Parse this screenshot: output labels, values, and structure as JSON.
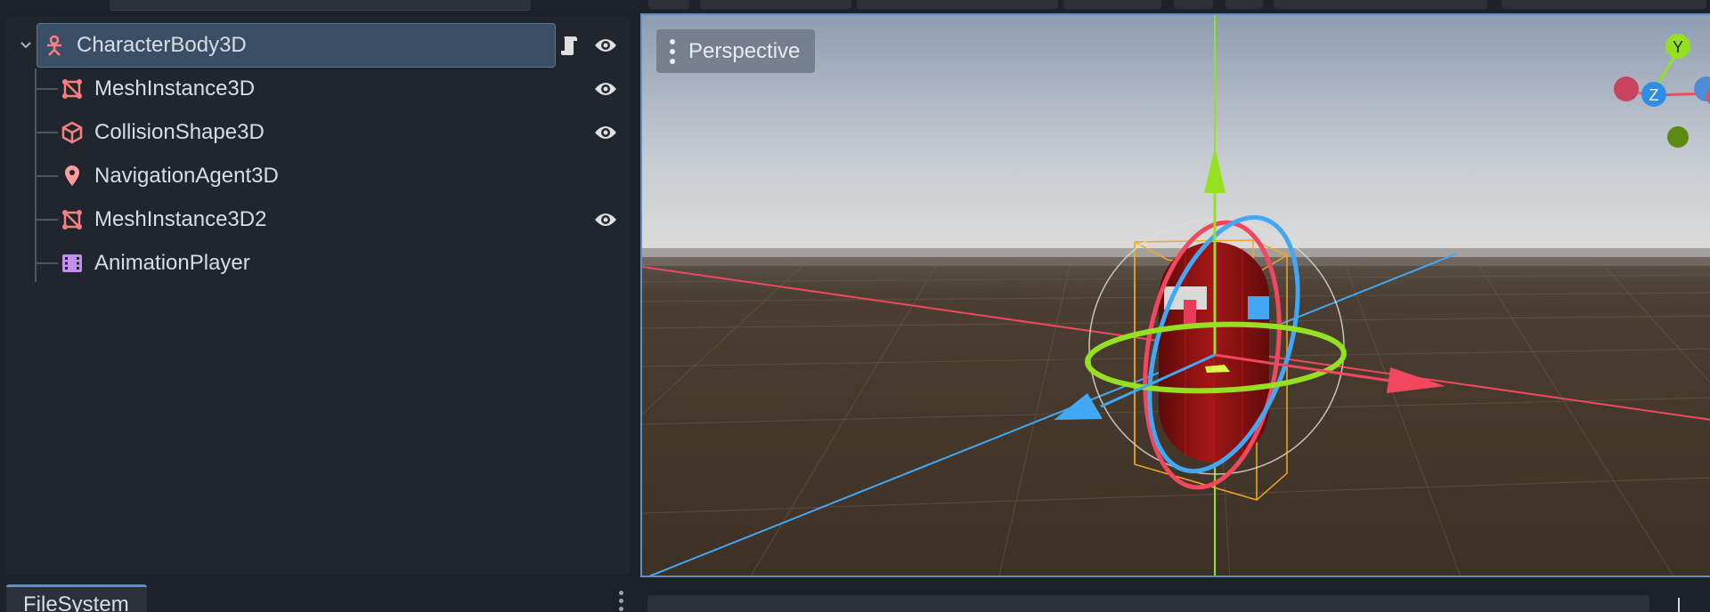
{
  "scene_tree": {
    "root": {
      "label": "CharacterBody3D",
      "icon": "character-body-icon",
      "color": "#fc7f7f"
    },
    "children": [
      {
        "label": "MeshInstance3D",
        "icon": "mesh-instance-icon",
        "visible_toggle": true
      },
      {
        "label": "CollisionShape3D",
        "icon": "collision-shape-icon",
        "visible_toggle": true
      },
      {
        "label": "NavigationAgent3D",
        "icon": "navigation-agent-icon",
        "visible_toggle": false
      },
      {
        "label": "MeshInstance3D2",
        "icon": "mesh-instance-icon",
        "visible_toggle": true
      },
      {
        "label": "AnimationPlayer",
        "icon": "animation-player-icon",
        "visible_toggle": false
      }
    ]
  },
  "viewport": {
    "view_menu_label": "Perspective",
    "gizmo_axes": [
      "Y",
      "Z"
    ],
    "colors": {
      "x_axis": "#f2475f",
      "y_axis": "#96e022",
      "z_axis": "#42a8f5",
      "capsule": "#8b1212",
      "selection_box": "#f5a623"
    }
  },
  "bottom_dock": {
    "tab_label": "FileSystem"
  },
  "colors": {
    "panel_bg": "#21262e",
    "selected_bg": "#3a4e66",
    "accent": "#5d8fc8"
  }
}
